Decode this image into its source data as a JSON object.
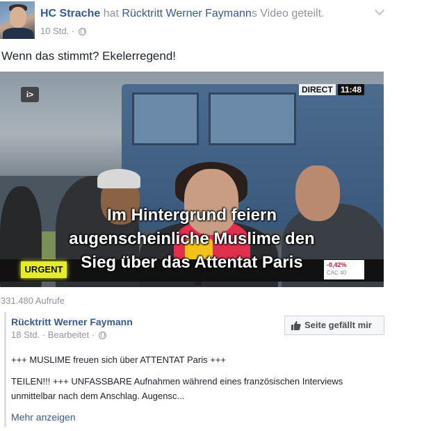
{
  "post": {
    "author": "HC Strache",
    "shared_prefix": "hat",
    "shared_page": "Rücktritt Werner Faymann",
    "shared_page_suffix": "s Video",
    "shared_suffix": "geteilt.",
    "time": "10 Std.",
    "separator": "·",
    "text": "Wenn das stimmt? Ekelerregend!"
  },
  "video": {
    "direct_label": "DIRECT",
    "direct_time": "11:48",
    "subtitle_lines": [
      "Im Hintergrund feiern",
      "augenscheinliche Muslime den",
      "Sieg über das Attentat Paris"
    ],
    "urgent_label": "URGENT",
    "ticker_value": "-0,42%",
    "ticker_label": "CAC 40",
    "views": "331.480 Aufrufe"
  },
  "source": {
    "page_name": "Rücktritt Werner Faymann",
    "time": "18 Std.",
    "separator": "·",
    "edited": "Bearbeitet",
    "like_button": "Seite gefällt mir",
    "text_line1": "+++ MUSLIME freuen sich über ATTENTAT Paris +++",
    "text_line2": "TEILEN!!! +++ UNFASSBARE Aufnahmen während eines französischen Interviews",
    "text_line3": "unmittelbar nach dem Anschlag. Augensc...",
    "more_link": "Mehr anzeigen"
  },
  "colors": {
    "link": "#365899",
    "meta": "#90949c",
    "scarf": "#e0304e",
    "urgent": "#e5ec2a"
  },
  "icons": {
    "privacy": "globe-icon",
    "menu": "chevron-down-icon",
    "like": "thumb-icon"
  }
}
